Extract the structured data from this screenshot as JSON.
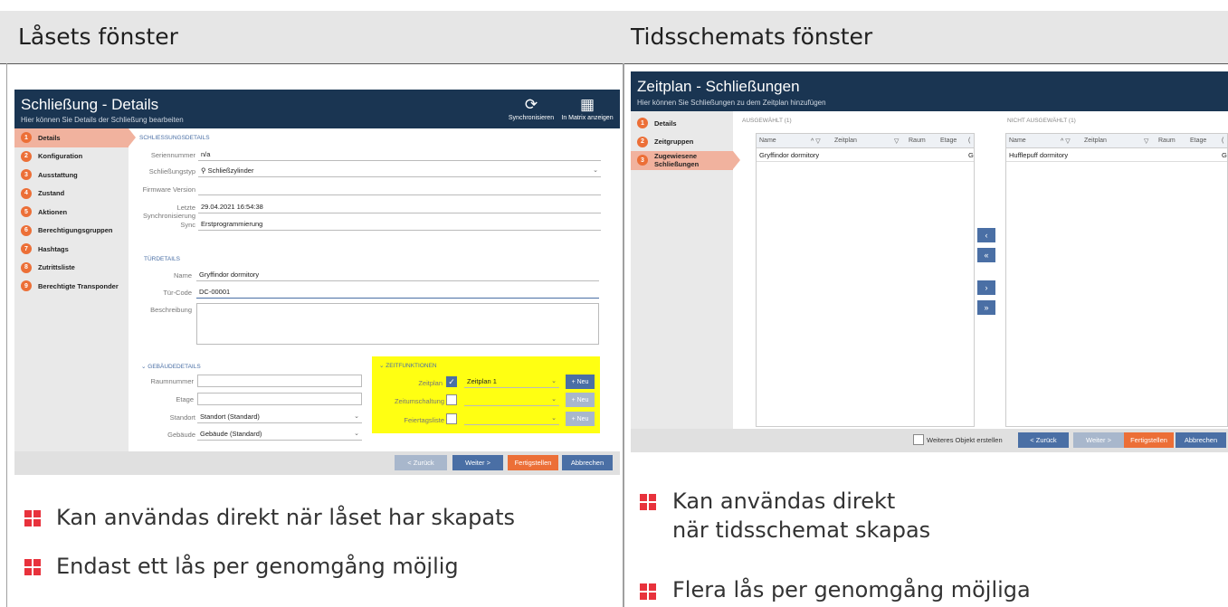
{
  "headings": {
    "left": "Låsets fönster",
    "right": "Tidsschemats fönster"
  },
  "left_window": {
    "title": "Schließung - Details",
    "subtitle": "Hier können Sie Details der Schließung bearbeiten",
    "toolbar": {
      "sync": "Synchronisieren",
      "matrix": "In Matrix anzeigen"
    },
    "nav": [
      {
        "n": "1",
        "label": "Details"
      },
      {
        "n": "2",
        "label": "Konfiguration"
      },
      {
        "n": "3",
        "label": "Ausstattung"
      },
      {
        "n": "4",
        "label": "Zustand"
      },
      {
        "n": "5",
        "label": "Aktionen"
      },
      {
        "n": "6",
        "label": "Berechtigungsgruppen"
      },
      {
        "n": "7",
        "label": "Hashtags"
      },
      {
        "n": "8",
        "label": "Zutrittsliste"
      },
      {
        "n": "9",
        "label": "Berechtigte Transponder"
      }
    ],
    "sec1": "SCHLIEßUNGSDETAILS",
    "fields": {
      "serial_l": "Seriennummer",
      "serial_v": "n/a",
      "typ_l": "Schließungstyp",
      "typ_v": "Schließzylinder",
      "fw_l": "Firmware Version",
      "fw_v": "",
      "last_l": "Letzte Synchronisierung",
      "last_v": "29.04.2021 16:54:38",
      "sync_l": "Sync",
      "sync_v": "Erstprogrammierung"
    },
    "sec2": "TÜRDETAILS",
    "door": {
      "name_l": "Name",
      "name_v": "Gryffindor dormitory",
      "code_l": "Tür-Code",
      "code_v": "DC-00001",
      "desc_l": "Beschreibung"
    },
    "sec3": "GEBÄUDEDETAILS",
    "bld": {
      "raum_l": "Raumnummer",
      "etage_l": "Etage",
      "standort_l": "Standort",
      "standort_v": "Standort (Standard)",
      "geb_l": "Gebäude",
      "geb_v": "Gebäude (Standard)"
    },
    "sec4": "ZEITFUNKTIONEN",
    "zeit": {
      "zp_l": "Zeitplan",
      "zp_v": "Zeitplan 1",
      "zu_l": "Zeitumschaltung",
      "ft_l": "Feiertagsliste",
      "neu": "+ Neu"
    },
    "buttons": {
      "back": "< Zurück",
      "next": "Weiter >",
      "finish": "Fertigstellen",
      "cancel": "Abbrechen"
    }
  },
  "right_window": {
    "title": "Zeitplan - Schließungen",
    "subtitle": "Hier können Sie Schließungen zu dem Zeitplan hinzufügen",
    "nav": [
      {
        "n": "1",
        "label": "Details"
      },
      {
        "n": "2",
        "label": "Zeitgruppen"
      },
      {
        "n": "3",
        "label": "Zugewiesene Schließungen"
      }
    ],
    "sel_label": "AUSGEWÄHLT (1)",
    "notsel_label": "NICHT AUSGEWÄHLT (1)",
    "cols": {
      "name": "Name",
      "zeitplan": "Zeitplan",
      "raum": "Raum",
      "etage": "Etage",
      "c": "("
    },
    "sel_row": "Gryffindor dormitory",
    "sel_row_c": "G",
    "notsel_row": "Hufflepuff dormitory",
    "notsel_row_c": "G",
    "arrows": {
      "left": "‹",
      "all_left": "«",
      "right": "›",
      "all_right": "»"
    },
    "more": "Weiteres Objekt erstellen",
    "buttons": {
      "back": "< Zurück",
      "next": "Weiter >",
      "finish": "Fertigstellen",
      "cancel": "Abbrechen"
    }
  },
  "bullets_left": [
    "Kan användas direkt när låset har skapats",
    "Endast ett lås per genomgång möjlig"
  ],
  "bullets_right": [
    "Kan användas direkt när tidsschemat skapas",
    "Flera lås per genomgång möjliga"
  ],
  "colors": {
    "navy": "#1a3552",
    "orange": "#ec6f37",
    "blue": "#4a6fa5",
    "yellow": "#ffff12",
    "bullet": "#e8323c"
  }
}
